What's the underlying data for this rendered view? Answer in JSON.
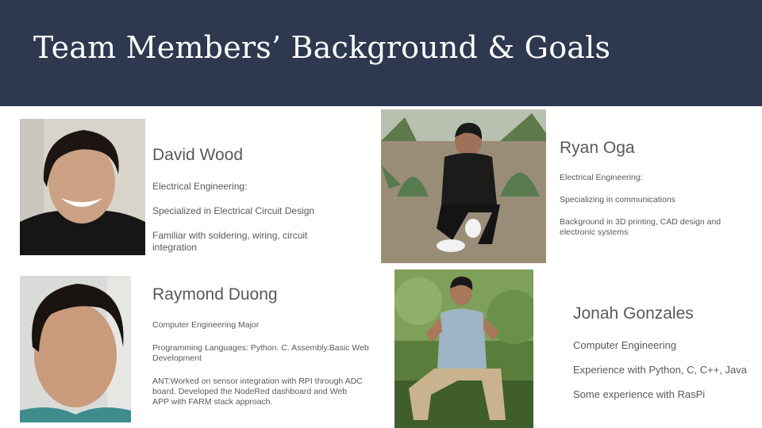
{
  "slide": {
    "title": "Team Members’ Background & Goals",
    "header_color": "#2e3950"
  },
  "members": [
    {
      "name": "David Wood",
      "photo": "portrait-photo",
      "lines": [
        "Electrical Engineering:",
        "Specialized  in Electrical Circuit Design",
        "Familiar with soldering, wiring, circuit integration"
      ]
    },
    {
      "name": "Ryan Oga",
      "photo": "portrait-photo",
      "lines": [
        "Electrical Engineering:",
        "Specializing in communications",
        "Background in 3D printing, CAD design and electronic systems"
      ]
    },
    {
      "name": "Raymond Duong",
      "photo": "portrait-photo",
      "lines": [
        "Computer Engineering Major",
        "Programming Languages: Python. C. Assembly.Basic Web Development",
        "ANT:Worked on sensor integration with RPI through ADC board. Developed the NodeRed dashboard and Web APP with FARM stack approach."
      ]
    },
    {
      "name": "Jonah Gonzales",
      "photo": "portrait-photo",
      "lines": [
        "Computer Engineering",
        "Experience with Python, C, C++, Java",
        "Some experience with RasPi"
      ]
    }
  ]
}
